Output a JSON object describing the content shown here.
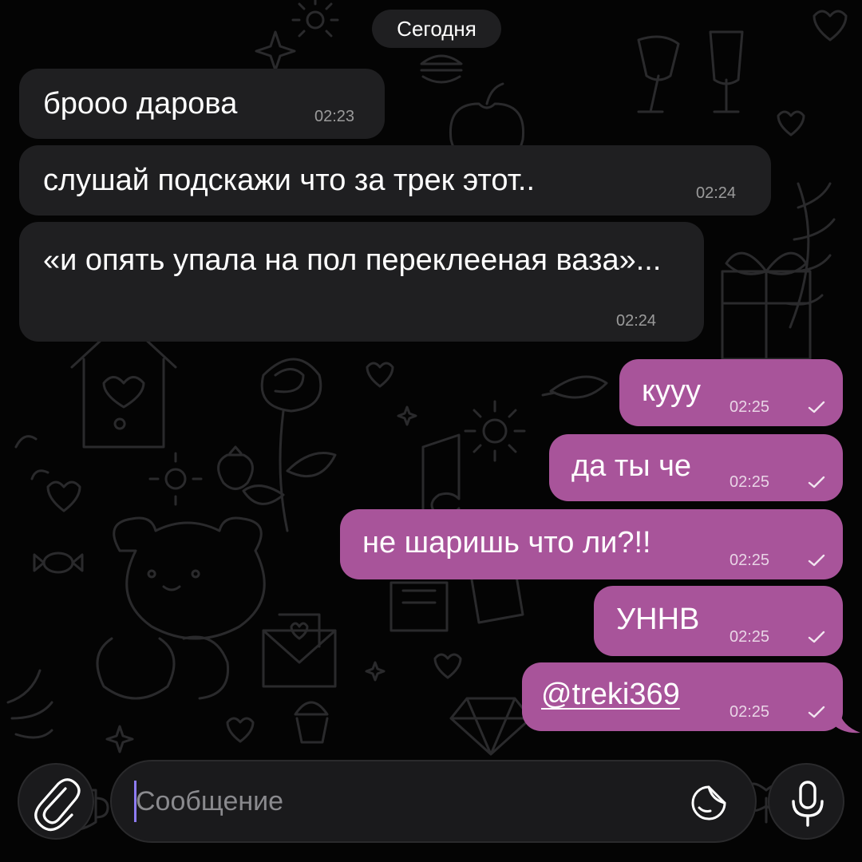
{
  "date_separator": "Сегодня",
  "messages": [
    {
      "direction": "in",
      "text": "брооо дарова",
      "time": "02:23"
    },
    {
      "direction": "in",
      "text": "слушай подскажи что за трек этот..",
      "time": "02:24"
    },
    {
      "direction": "in",
      "text": "«и опять упала на пол переклееная ваза»...",
      "time": "02:24"
    },
    {
      "direction": "out",
      "text": "кууу",
      "time": "02:25",
      "status": "sent"
    },
    {
      "direction": "out",
      "text": "да ты че",
      "time": "02:25",
      "status": "sent"
    },
    {
      "direction": "out",
      "text": "не шаришь что ли?!!",
      "time": "02:25",
      "status": "sent"
    },
    {
      "direction": "out",
      "text": "УННВ",
      "time": "02:25",
      "status": "sent"
    },
    {
      "direction": "out",
      "text": "@treki369",
      "time": "02:25",
      "status": "sent",
      "is_mention": true
    }
  ],
  "composer": {
    "placeholder": "Сообщение",
    "value": "",
    "attach_icon": "paperclip-icon",
    "sticker_icon": "sticker-icon",
    "voice_icon": "microphone-icon"
  },
  "colors": {
    "incoming_bubble": "#1f1f21",
    "outgoing_bubble": "#a8549a",
    "caret": "#8e7cf5",
    "background": "#040404"
  }
}
